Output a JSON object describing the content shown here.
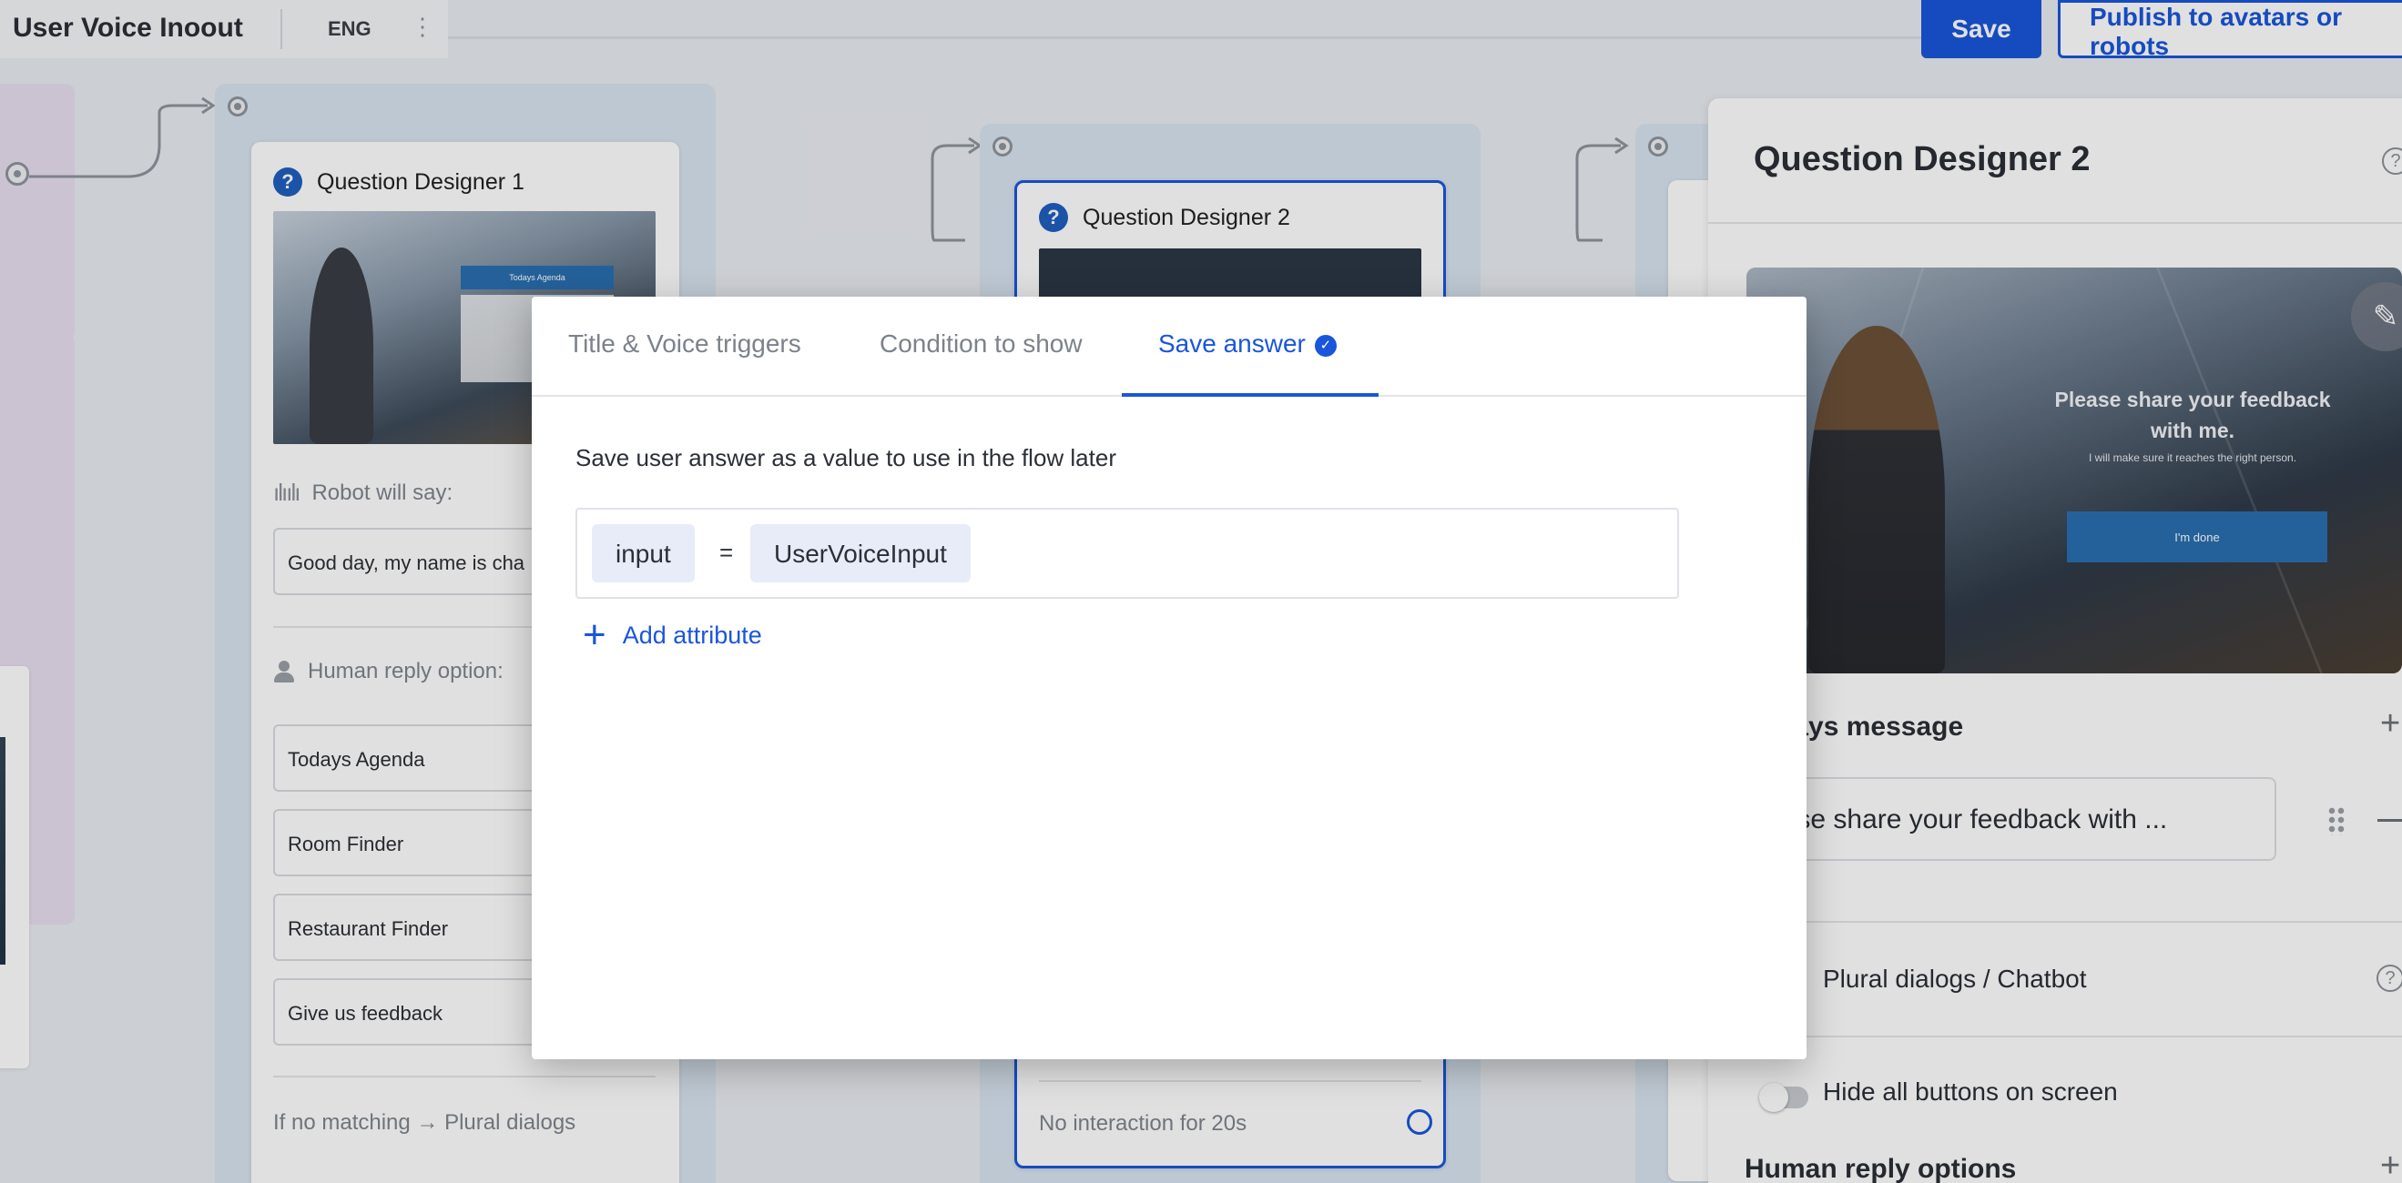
{
  "header": {
    "app_title": "User Voice Inoout",
    "language": "ENG",
    "save_label": "Save",
    "publish_label": "Publish to avatars or robots"
  },
  "canvas": {
    "node1": {
      "title": "Question Designer 1",
      "robot_label": "Robot will say:",
      "robot_text": "Good day, my name is cha",
      "human_label": "Human reply option:",
      "replies": [
        "Todays Agenda",
        "Room Finder",
        "Restaurant Finder",
        "Give us feedback"
      ],
      "fallback": "If no matching → Plural dialogs",
      "image_menu": [
        "Todays Agenda"
      ]
    },
    "node2": {
      "title": "Question Designer 2",
      "footer": "No interaction for 20s"
    }
  },
  "panel": {
    "title": "Question Designer 2",
    "preview_message": "Please share your feedback with me.",
    "preview_sub": "I will make sure it reaches the right person.",
    "preview_button": "I'm done",
    "robot_section": "ot says message",
    "message_value": "ease share your feedback with ...",
    "plural_label": "Plural dialogs / Chatbot",
    "hide_buttons_label": "Hide all buttons on screen",
    "human_section": "Human reply options"
  },
  "modal": {
    "tabs": [
      "Title & Voice triggers",
      "Condition to show",
      "Save answer"
    ],
    "active_tab": 2,
    "description": "Save user answer as a value to use in the flow later",
    "attribute": {
      "key": "input",
      "operator": "=",
      "value": "UserVoiceInput"
    },
    "add_attribute_label": "Add attribute"
  },
  "colors": {
    "accent": "#1a56db",
    "overlay": "rgba(0,0,0,0.12)"
  },
  "icons": [
    "kebab-menu-icon",
    "question-icon",
    "soundwave-icon",
    "person-icon",
    "help-icon",
    "edit-pencil-icon",
    "drag-handle-icon",
    "plus-icon",
    "minus-icon",
    "check-circle-icon"
  ]
}
